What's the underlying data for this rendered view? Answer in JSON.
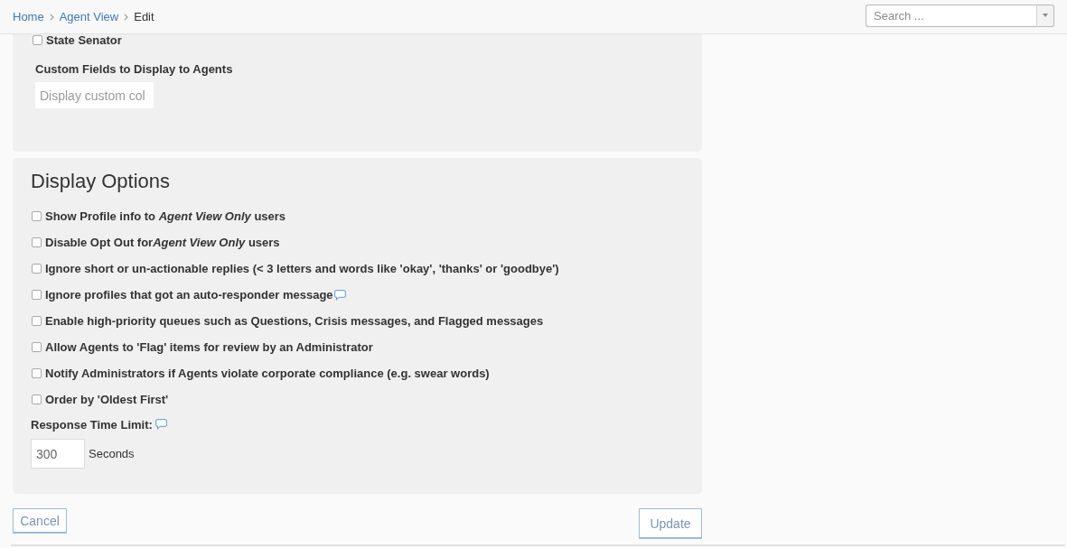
{
  "breadcrumb": [
    {
      "label": "Home",
      "kind": "link"
    },
    {
      "label": "Agent View",
      "kind": "link"
    },
    {
      "label": "Edit",
      "kind": "current"
    }
  ],
  "search": {
    "placeholder": "Search ..."
  },
  "audience_panel": {
    "options": [
      {
        "label": "State Senator",
        "checked": false
      }
    ],
    "custom_fields": {
      "label": "Custom Fields to Display to Agents",
      "placeholder": "Display custom col"
    }
  },
  "display_options": {
    "title": "Display Options",
    "options": [
      {
        "label_parts": [
          {
            "text": "Show Profile info to ",
            "italic": false
          },
          {
            "text": "Agent View Only",
            "italic": true
          },
          {
            "text": " users",
            "italic": false
          }
        ],
        "checked": false,
        "has_tooltip": false
      },
      {
        "label_parts": [
          {
            "text": "Disable Opt Out for",
            "italic": false
          },
          {
            "text": "Agent View Only",
            "italic": true
          },
          {
            "text": " users",
            "italic": false
          }
        ],
        "checked": false,
        "has_tooltip": false
      },
      {
        "label_parts": [
          {
            "text": "Ignore short or un-actionable replies (< 3 letters and words like 'okay', 'thanks' or 'goodbye')",
            "italic": false
          }
        ],
        "checked": false,
        "has_tooltip": false
      },
      {
        "label_parts": [
          {
            "text": "Ignore profiles that got an auto-responder message",
            "italic": false
          }
        ],
        "checked": false,
        "has_tooltip": true
      },
      {
        "label_parts": [
          {
            "text": "Enable high-priority queues such as Questions, Crisis messages, and Flagged messages",
            "italic": false
          }
        ],
        "checked": false,
        "has_tooltip": false
      },
      {
        "label_parts": [
          {
            "text": "Allow Agents to 'Flag' items for review by an Administrator",
            "italic": false
          }
        ],
        "checked": false,
        "has_tooltip": false
      },
      {
        "label_parts": [
          {
            "text": "Notify Administrators if Agents violate corporate compliance (e.g. swear words)",
            "italic": false
          }
        ],
        "checked": false,
        "has_tooltip": false
      },
      {
        "label_parts": [
          {
            "text": "Order by 'Oldest First'",
            "italic": false
          }
        ],
        "checked": false,
        "has_tooltip": false
      }
    ],
    "response_time": {
      "label": "Response Time Limit:",
      "has_tooltip": true,
      "value": "300",
      "unit": "Seconds"
    }
  },
  "buttons": [
    {
      "label": "Cancel",
      "kind": "cancel"
    },
    {
      "label": "Update",
      "kind": "update"
    }
  ]
}
